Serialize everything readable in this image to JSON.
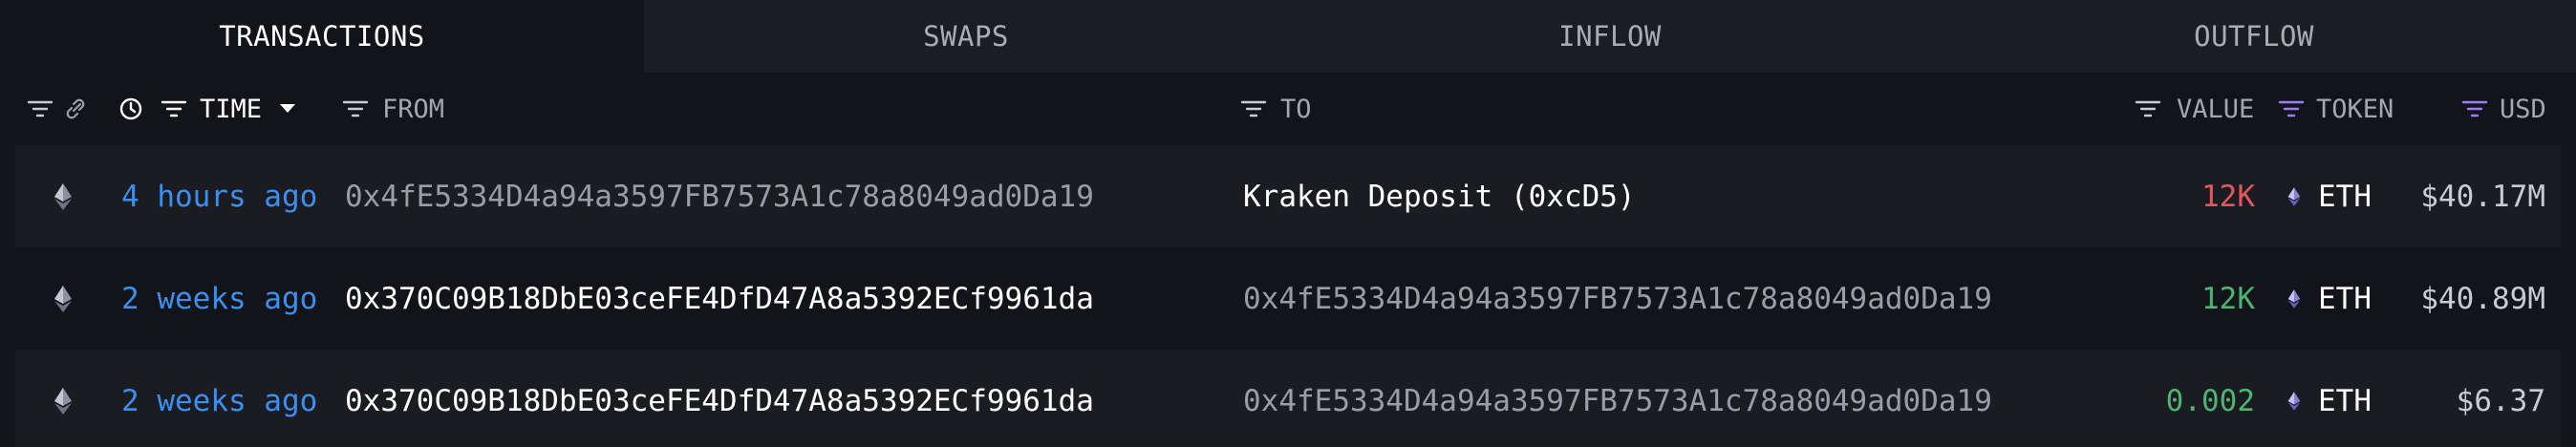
{
  "tabs": [
    {
      "label": "TRANSACTIONS",
      "active": true
    },
    {
      "label": "SWAPS",
      "active": false
    },
    {
      "label": "INFLOW",
      "active": false
    },
    {
      "label": "OUTFLOW",
      "active": false
    }
  ],
  "columns": {
    "time": "TIME",
    "from": "FROM",
    "to": "TO",
    "value": "VALUE",
    "token": "TOKEN",
    "usd": "USD"
  },
  "rows": [
    {
      "time": "4 hours ago",
      "from": "0x4fE5334D4a94a3597FB7573A1c78a8049ad0Da19",
      "to": "Kraken Deposit (0xcD5)",
      "value": "12K",
      "value_direction": "out",
      "token": "ETH",
      "usd": "$40.17M"
    },
    {
      "time": "2 weeks ago",
      "from": "0x370C09B18DbE03ceFE4DfD47A8a5392ECf9961da",
      "to": "0x4fE5334D4a94a3597FB7573A1c78a8049ad0Da19",
      "value": "12K",
      "value_direction": "in",
      "token": "ETH",
      "usd": "$40.89M"
    },
    {
      "time": "2 weeks ago",
      "from": "0x370C09B18DbE03ceFE4DfD47A8a5392ECf9961da",
      "to": "0x4fE5334D4a94a3597FB7573A1c78a8049ad0Da19",
      "value": "0.002",
      "value_direction": "in",
      "token": "ETH",
      "usd": "$6.37"
    }
  ],
  "colors": {
    "link_blue": "#3b8ff0",
    "value_out": "#e0575d",
    "value_in": "#4fb371",
    "filter_accent": "#9b7cf5"
  },
  "icons": [
    "filter-icon",
    "link-icon",
    "clock-icon",
    "caret-down-icon",
    "ethereum-icon"
  ]
}
